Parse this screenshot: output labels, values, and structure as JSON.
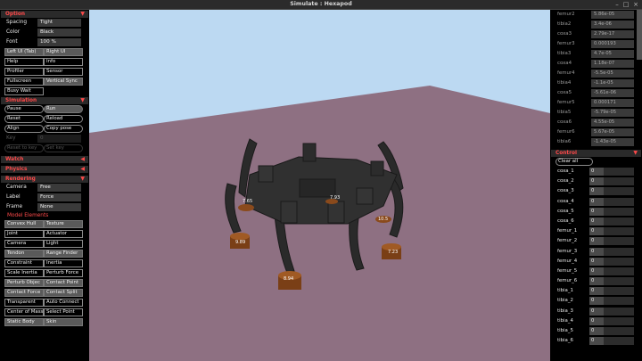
{
  "window": {
    "title": "Simulate : Hexapod"
  },
  "left": {
    "option": {
      "header": "Option",
      "fields": [
        {
          "label": "Spacing",
          "value": "Tight"
        },
        {
          "label": "Color",
          "value": "Black"
        },
        {
          "label": "Font",
          "value": "100 %"
        }
      ],
      "buttons": [
        [
          "Left UI (Tab)",
          "Right UI"
        ],
        [
          "Help",
          "Info"
        ],
        [
          "Profiler",
          "Sensor"
        ],
        [
          "Fullscreen",
          "Vertical Sync"
        ],
        [
          "Busy Wait",
          ""
        ]
      ]
    },
    "simulation": {
      "header": "Simulation",
      "buttons": [
        [
          "Pause",
          "Run"
        ],
        [
          "Reset",
          "Reload"
        ],
        [
          "Align",
          "Copy pose"
        ]
      ],
      "key_label": "Key",
      "key_value": "0",
      "reset_to_key": "Reset to key",
      "set_key": "Set key"
    },
    "watch": {
      "header": "Watch"
    },
    "physics": {
      "header": "Physics"
    },
    "rendering": {
      "header": "Rendering",
      "fields": [
        {
          "label": "Camera",
          "value": "Free"
        },
        {
          "label": "Label",
          "value": "Force"
        },
        {
          "label": "Frame",
          "value": "None"
        }
      ],
      "model_elements_header": "Model Elements",
      "buttons": [
        [
          "Convex Hull",
          "Texture"
        ],
        [
          "Joint",
          "Actuator"
        ],
        [
          "Camera",
          "Light"
        ],
        [
          "Tendon",
          "Range Finder"
        ],
        [
          "Constraint",
          "Inertia"
        ],
        [
          "Scale Inertia",
          "Perturb Force"
        ],
        [
          "Perturb Objec",
          "Contact Point"
        ],
        [
          "Contact Force",
          "Contact Split"
        ],
        [
          "Transparent",
          "Auto Connect"
        ],
        [
          "Center of Mass",
          "Select Point"
        ],
        [
          "Static Body",
          "Skin"
        ]
      ]
    }
  },
  "right": {
    "sensors": [
      {
        "name": "femur2",
        "value": "5.86e-05"
      },
      {
        "name": "tibia2",
        "value": "3.4e-06"
      },
      {
        "name": "coxa3",
        "value": "2.79e-17"
      },
      {
        "name": "femur3",
        "value": "0.000193"
      },
      {
        "name": "tibia3",
        "value": "4.7e-05"
      },
      {
        "name": "coxa4",
        "value": "1.18e-07"
      },
      {
        "name": "femur4",
        "value": "-5.5e-05"
      },
      {
        "name": "tibia4",
        "value": "-1.1e-05"
      },
      {
        "name": "coxa5",
        "value": "-5.61e-06"
      },
      {
        "name": "femur5",
        "value": "0.000171"
      },
      {
        "name": "tibia5",
        "value": "-5.79e-05"
      },
      {
        "name": "coxa6",
        "value": "4.55e-05"
      },
      {
        "name": "femur6",
        "value": "5.67e-05"
      },
      {
        "name": "tibia6",
        "value": "-1.43e-05"
      }
    ],
    "control": {
      "header": "Control",
      "clear_all": "Clear all",
      "items": [
        {
          "name": "coxa_1",
          "value": "0"
        },
        {
          "name": "coxa_2",
          "value": "0"
        },
        {
          "name": "coxa_3",
          "value": "0"
        },
        {
          "name": "coxa_4",
          "value": "0"
        },
        {
          "name": "coxa_5",
          "value": "0"
        },
        {
          "name": "coxa_6",
          "value": "0"
        },
        {
          "name": "femur_1",
          "value": "0"
        },
        {
          "name": "femur_2",
          "value": "0"
        },
        {
          "name": "femur_3",
          "value": "0"
        },
        {
          "name": "femur_4",
          "value": "0"
        },
        {
          "name": "femur_5",
          "value": "0"
        },
        {
          "name": "femur_6",
          "value": "0"
        },
        {
          "name": "tibia_1",
          "value": "0"
        },
        {
          "name": "tibia_2",
          "value": "0"
        },
        {
          "name": "tibia_3",
          "value": "0"
        },
        {
          "name": "tibia_4",
          "value": "0"
        },
        {
          "name": "tibia_5",
          "value": "0"
        },
        {
          "name": "tibia_6",
          "value": "0"
        }
      ]
    }
  },
  "scene": {
    "contact_labels": [
      "7.65",
      "10.5",
      "9.89",
      "7.23",
      "8.94",
      "7.93"
    ],
    "colors": {
      "sky": "#bcd9f2",
      "floor": "#8e7082",
      "robot": "#2a2a2a",
      "foot": "#8a4a1c"
    }
  }
}
